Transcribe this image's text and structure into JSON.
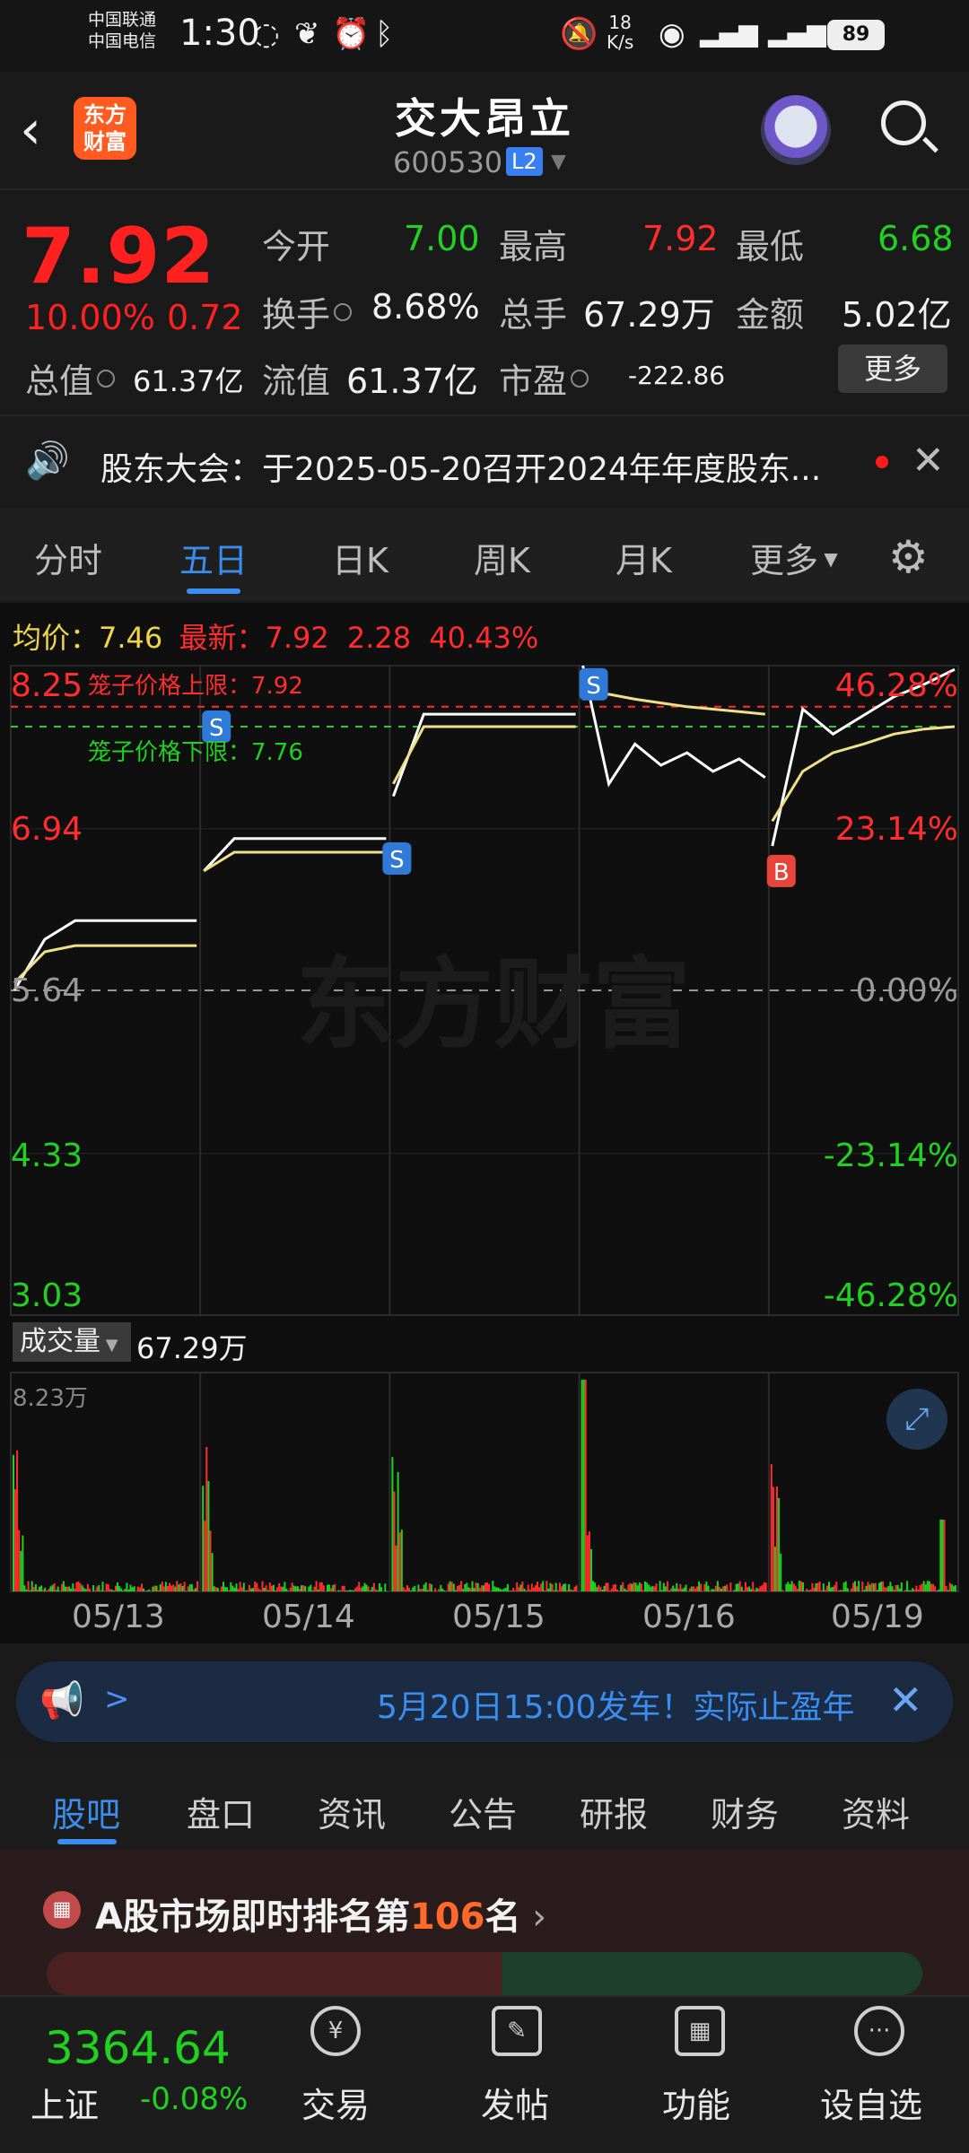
{
  "status_bar": {
    "carrier1": "中国联通",
    "carrier2": "中国电信",
    "time": "1:30",
    "speed_value": "18",
    "speed_unit": "K/s",
    "battery": "89"
  },
  "header": {
    "brand_line1": "东方",
    "brand_line2": "财富",
    "stock_name": "交大昂立",
    "stock_code": "600530",
    "level_badge": "L2"
  },
  "quote": {
    "price": "7.92",
    "change_pct": "10.00%",
    "change": "0.72",
    "open_label": "今开",
    "open": "7.00",
    "high_label": "最高",
    "high": "7.92",
    "low_label": "最低",
    "low": "6.68",
    "turnover_label": "换手",
    "turnover": "8.68%",
    "volume_label": "总手",
    "volume": "67.29万",
    "amount_label": "金额",
    "amount": "5.02亿",
    "mktcap_label": "总值",
    "mktcap": "61.37亿",
    "float_label": "流值",
    "float": "61.37亿",
    "pe_label": "市盈",
    "pe": "-222.86",
    "more_label": "更多"
  },
  "notice": {
    "text": "股东大会：于2025-05-20召开2024年年度股东..."
  },
  "chart_tabs": [
    "分时",
    "五日",
    "日K",
    "周K",
    "月K",
    "更多"
  ],
  "chart_header": {
    "avg_label": "均价：",
    "avg": "7.46",
    "latest_label": "最新：",
    "latest": "7.92",
    "latest_chg": "2.28",
    "latest_pct": "40.43%"
  },
  "chart_annotations": {
    "upper_limit": "笼子价格上限：7.92",
    "lower_limit": "笼子价格下限：7.76",
    "watermark": "东方财富",
    "sell_marker": "S",
    "buy_marker": "B"
  },
  "volume": {
    "label": "成交量",
    "value": "67.29万",
    "max_label": "8.23万"
  },
  "chart_data": {
    "type": "line",
    "title": "",
    "x_dates": [
      "05/13",
      "05/14",
      "05/15",
      "05/16",
      "05/19"
    ],
    "y_left_ticks": [
      "8.25",
      "6.94",
      "5.64",
      "4.33",
      "3.03"
    ],
    "y_right_ticks": [
      "46.28%",
      "23.14%",
      "0.00%",
      "-23.14%",
      "-46.28%"
    ],
    "ylim": [
      3.03,
      8.25
    ],
    "baseline": 5.64,
    "series": [
      {
        "name": "最新",
        "color": "#ffffff",
        "days": [
          [
            5.64,
            6.05,
            6.2,
            6.2,
            6.2,
            6.2,
            6.2
          ],
          [
            6.6,
            6.86,
            6.86,
            6.86,
            6.86,
            6.86,
            6.86
          ],
          [
            7.2,
            7.86,
            7.86,
            7.86,
            7.86,
            7.86,
            7.86
          ],
          [
            8.25,
            7.3,
            7.62,
            7.45,
            7.55,
            7.4,
            7.5,
            7.35
          ],
          [
            6.8,
            7.9,
            7.7,
            7.85,
            8.0,
            8.1,
            8.22
          ]
        ]
      },
      {
        "name": "均价",
        "color": "#f0e08a",
        "days": [
          [
            5.7,
            5.95,
            6.0,
            6.0,
            6.0,
            6.0,
            6.0
          ],
          [
            6.6,
            6.75,
            6.75,
            6.75,
            6.75,
            6.75,
            6.75
          ],
          [
            7.3,
            7.76,
            7.76,
            7.76,
            7.76,
            7.76,
            7.76
          ],
          [
            7.98,
            8.02,
            7.98,
            7.95,
            7.92,
            7.9,
            7.88,
            7.86
          ],
          [
            7.0,
            7.4,
            7.55,
            7.62,
            7.7,
            7.74,
            7.76
          ]
        ]
      }
    ],
    "upper_limit": 7.92,
    "lower_limit": 7.76,
    "volume_ticks": "8.23万"
  },
  "promo": {
    "text": "5月20日15:00发车！实际止盈年"
  },
  "bottom_tabs": [
    "股吧",
    "盘口",
    "资讯",
    "公告",
    "研报",
    "财务",
    "资料"
  ],
  "ranking": {
    "prefix": "A股市场即时排名第",
    "number": "106",
    "suffix": "名"
  },
  "nav": {
    "index_value": "3364.64",
    "index_name": "上证",
    "index_chg": "-0.08%",
    "items": [
      "交易",
      "发帖",
      "功能",
      "设自选"
    ]
  },
  "colors": {
    "up": "#ff2d2d",
    "down": "#22d022",
    "accent": "#3a8ef0"
  }
}
